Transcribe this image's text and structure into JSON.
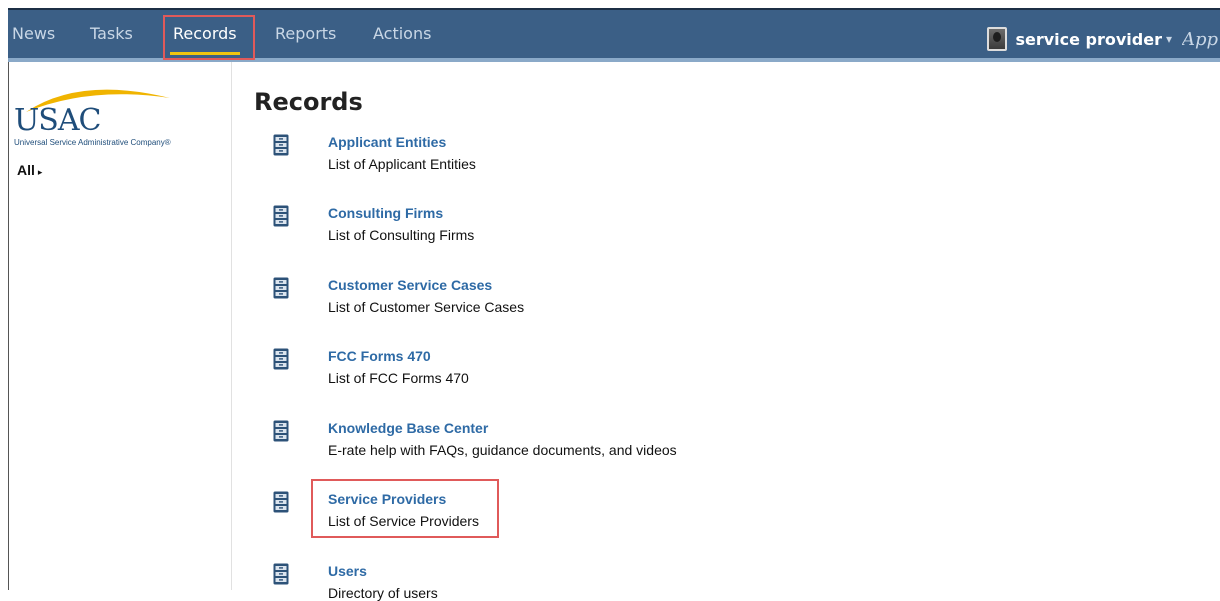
{
  "nav": {
    "items": [
      {
        "label": "News"
      },
      {
        "label": "Tasks"
      },
      {
        "label": "Records"
      },
      {
        "label": "Reports"
      },
      {
        "label": "Actions"
      }
    ],
    "active": "Records",
    "user_name": "service provider",
    "user_caret": "▾",
    "app_label": "App"
  },
  "sidebar": {
    "logo_text": "USAC",
    "logo_subtext": "Universal Service Administrative Company®",
    "filter_label": "All",
    "filter_caret": "▸"
  },
  "main": {
    "title": "Records",
    "records": [
      {
        "title": "Applicant Entities",
        "description": "List of Applicant Entities"
      },
      {
        "title": "Consulting Firms",
        "description": "List of Consulting Firms"
      },
      {
        "title": "Customer Service Cases",
        "description": "List of Customer Service Cases"
      },
      {
        "title": "FCC Forms 470",
        "description": "List of FCC Forms 470"
      },
      {
        "title": "Knowledge Base Center",
        "description": "E-rate help with FAQs, guidance documents, and videos"
      },
      {
        "title": "Service Providers",
        "description": "List of Service Providers"
      },
      {
        "title": "Users",
        "description": "Directory of users"
      }
    ]
  },
  "colors": {
    "topbar": "#3b5f86",
    "link": "#2e6aa5",
    "highlight": "#e05a5a",
    "active_underline": "#f1c40f"
  },
  "icons": {
    "record": "file-cabinet-icon",
    "user": "avatar-icon",
    "logo_swoosh": "swoosh-icon"
  }
}
